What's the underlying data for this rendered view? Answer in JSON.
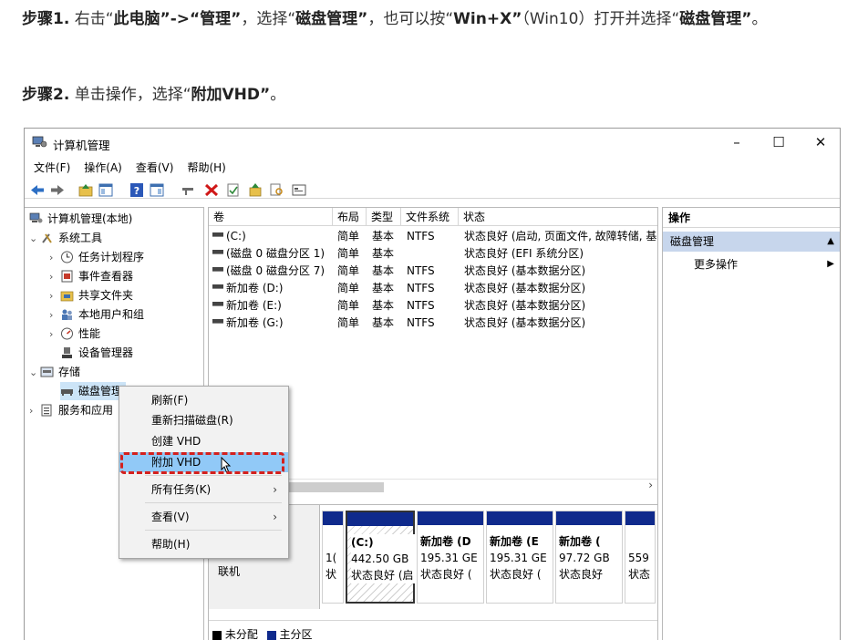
{
  "article": {
    "step1_label": "步骤1.",
    "step1_text_a": " 右击“",
    "step1_bold_a": "此电脑”->“管理”",
    "step1_text_b": "，选择“",
    "step1_bold_b": "磁盘管理”",
    "step1_text_c": "，也可以按“",
    "step1_bold_c": "Win+X”",
    "step1_text_d": "（Win10）打开并选择“",
    "step1_bold_d": "磁盘管理”",
    "step1_text_e": "。",
    "step2_label": "步骤2.",
    "step2_text_a": " 单击操作，选择“",
    "step2_bold_a": "附加VHD”",
    "step2_text_b": "。"
  },
  "window": {
    "title": "计算机管理",
    "minimize": "–",
    "maximize": "☐",
    "close": "✕"
  },
  "menubar": [
    "文件(F)",
    "操作(A)",
    "查看(V)",
    "帮助(H)"
  ],
  "toolbar_icons": [
    "back-arrow-icon",
    "forward-arrow-icon",
    "up-folder-icon",
    "console-tree-icon",
    "help-icon",
    "properties-icon",
    "connect-icon",
    "delete-icon",
    "check-icon",
    "folder-up-icon",
    "search-icon",
    "view-icon"
  ],
  "tree": {
    "root": "计算机管理(本地)",
    "system_tools": "系统工具",
    "task_scheduler": "任务计划程序",
    "event_viewer": "事件查看器",
    "shared_folders": "共享文件夹",
    "local_users": "本地用户和组",
    "performance": "性能",
    "device_manager": "设备管理器",
    "storage": "存储",
    "disk_management": "磁盘管理",
    "services": "服务和应用"
  },
  "volume_table": {
    "headers": [
      "卷",
      "布局",
      "类型",
      "文件系统",
      "状态"
    ],
    "rows": [
      {
        "vol": "(C:)",
        "layout": "简单",
        "type": "基本",
        "fs": "NTFS",
        "status": "状态良好 (启动, 页面文件, 故障转储, 基"
      },
      {
        "vol": "(磁盘 0 磁盘分区 1)",
        "layout": "简单",
        "type": "基本",
        "fs": "",
        "status": "状态良好 (EFI 系统分区)"
      },
      {
        "vol": "(磁盘 0 磁盘分区 7)",
        "layout": "简单",
        "type": "基本",
        "fs": "NTFS",
        "status": "状态良好 (基本数据分区)"
      },
      {
        "vol": "新加卷 (D:)",
        "layout": "简单",
        "type": "基本",
        "fs": "NTFS",
        "status": "状态良好 (基本数据分区)"
      },
      {
        "vol": "新加卷 (E:)",
        "layout": "简单",
        "type": "基本",
        "fs": "NTFS",
        "status": "状态良好 (基本数据分区)"
      },
      {
        "vol": "新加卷 (G:)",
        "layout": "简单",
        "type": "基本",
        "fs": "NTFS",
        "status": "状态良好 (基本数据分区)"
      }
    ],
    "scroll_right": "›"
  },
  "graphical": {
    "disk_status": "联机",
    "partitions": [
      {
        "name": "",
        "size": "1(",
        "status": "状"
      },
      {
        "name": "(C:)",
        "size": "442.50 GB",
        "status": "状态良好 (启"
      },
      {
        "name": "新加卷 (D",
        "size": "195.31 GE",
        "status": "状态良好 ("
      },
      {
        "name": "新加卷 (E",
        "size": "195.31 GE",
        "status": "状态良好 ("
      },
      {
        "name": "新加卷 (",
        "size": "97.72 GB",
        "status": "状态良好"
      },
      {
        "name": "",
        "size": "559",
        "status": "状态"
      }
    ],
    "legend_unalloc": "未分配",
    "legend_primary": "主分区"
  },
  "actions": {
    "header": "操作",
    "selected": "磁盘管理",
    "selected_arrow": "▲",
    "more": "更多操作",
    "more_arrow": "▶"
  },
  "context_menu": {
    "refresh": "刷新(F)",
    "rescan": "重新扫描磁盘(R)",
    "create_vhd": "创建 VHD",
    "attach_vhd": "附加 VHD",
    "all_tasks": "所有任务(K)",
    "view": "查看(V)",
    "help": "帮助(H)",
    "submenu_arrow": "›"
  },
  "colors": {
    "partition_bar": "#0f2a8c",
    "highlight": "#91c9f7",
    "dash_border": "#d4201d",
    "action_selected": "#c7d6ec"
  }
}
